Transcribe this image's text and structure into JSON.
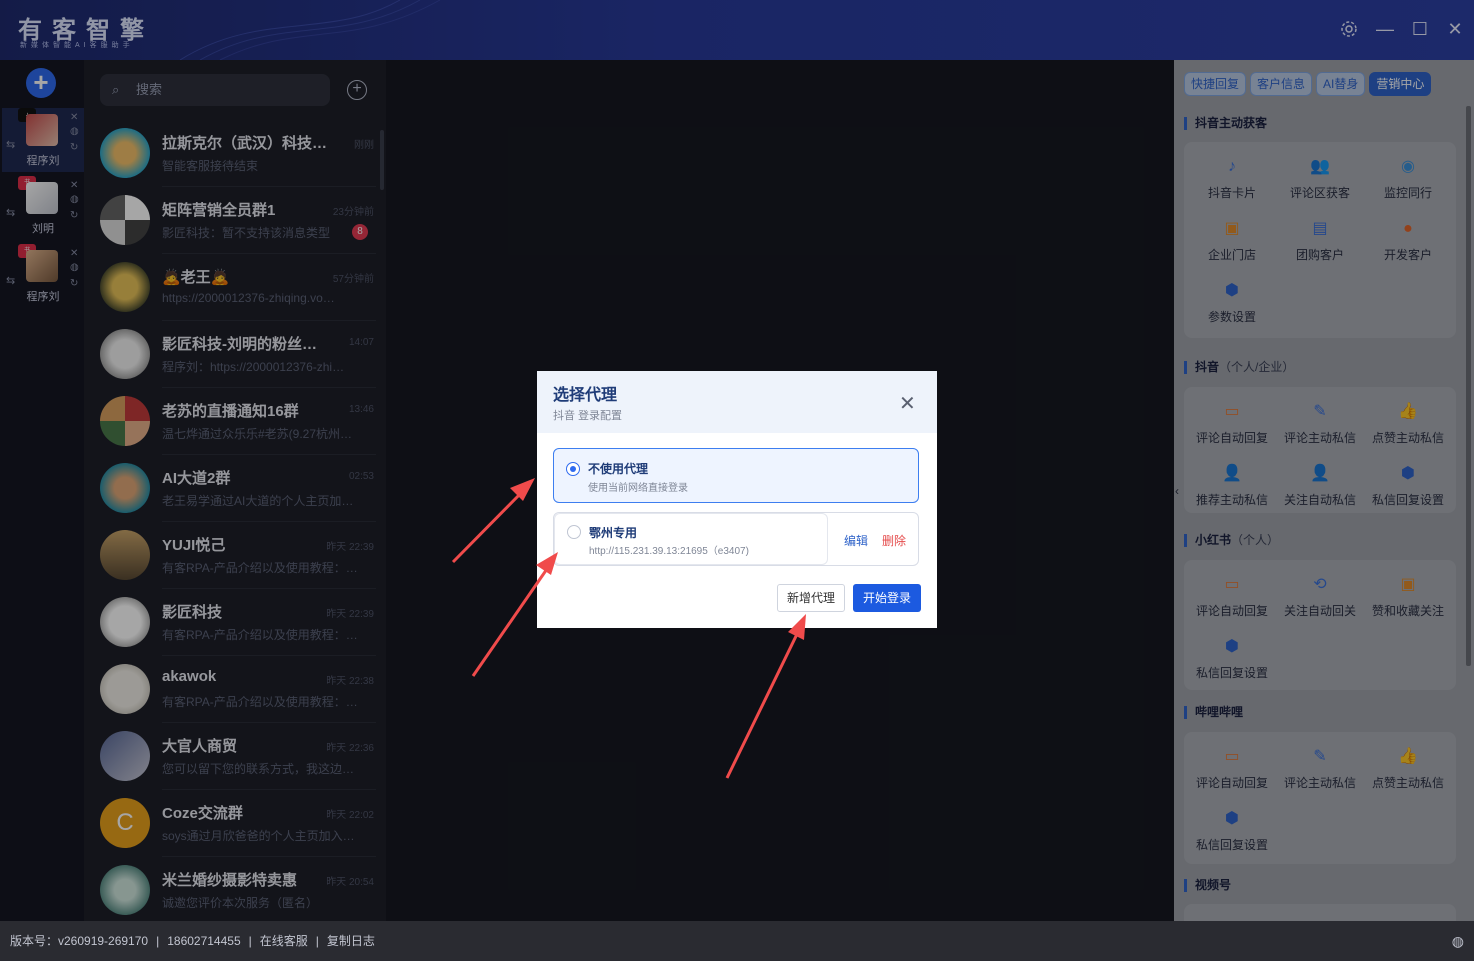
{
  "app": {
    "logo_title": "有客智擎",
    "logo_subtitle": "新媒体智能AI客服助手",
    "window_icons": [
      "gear-icon",
      "minimize-icon",
      "maximize-icon",
      "close-icon"
    ]
  },
  "accounts": [
    {
      "name": "程序刘",
      "platform": "抖音"
    },
    {
      "name": "刘明",
      "platform": "小红书"
    },
    {
      "name": "程序刘",
      "platform": "小红书"
    }
  ],
  "chat": {
    "search_placeholder": "搜索",
    "items": [
      {
        "name": "拉斯克尔（武汉）科技…",
        "time": "刚刚",
        "msg": "智能客服接待结束",
        "unread": ""
      },
      {
        "name": "矩阵营销全员群1",
        "time": "23分钟前",
        "msg": "影匠科技：暂不支持该消息类型",
        "unread": "8"
      },
      {
        "name": "🙇老王🙇",
        "time": "57分钟前",
        "msg": "https://2000012376-zhiqing.vo…",
        "unread": ""
      },
      {
        "name": "影匠科技-刘明的粉丝…",
        "time": "14:07",
        "msg": "程序刘：https://2000012376-zhi…",
        "unread": ""
      },
      {
        "name": "老苏的直播通知16群",
        "time": "13:46",
        "msg": "温七烨通过众乐乐#老苏(9.27杭州…",
        "unread": ""
      },
      {
        "name": "AI大道2群",
        "time": "02:53",
        "msg": "老王易学通过AI大道的个人主页加…",
        "unread": ""
      },
      {
        "name": "YUJI悦己",
        "time": "昨天 22:39",
        "msg": "有客RPA-产品介绍以及使用教程：…",
        "unread": ""
      },
      {
        "name": "影匠科技",
        "time": "昨天 22:39",
        "msg": "有客RPA-产品介绍以及使用教程：…",
        "unread": ""
      },
      {
        "name": "akawok",
        "time": "昨天 22:38",
        "msg": "有客RPA-产品介绍以及使用教程：…",
        "unread": ""
      },
      {
        "name": "大官人商贸",
        "time": "昨天 22:36",
        "msg": "您可以留下您的联系方式，我这边…",
        "unread": ""
      },
      {
        "name": "Coze交流群",
        "time": "昨天 22:02",
        "msg": "soys通过月欣爸爸的个人主页加入…",
        "unread": ""
      },
      {
        "name": "米兰婚纱摄影特卖惠",
        "time": "昨天 20:54",
        "msg": "诚邀您评价本次服务（匿名）",
        "unread": ""
      }
    ]
  },
  "right_panel": {
    "tabs": [
      "快捷回复",
      "客户信息",
      "AI替身",
      "营销中心"
    ],
    "active_tab": "营销中心",
    "sections": [
      {
        "title": "抖音主动获客",
        "suffix": "",
        "tools": [
          "抖音卡片",
          "评论区获客",
          "监控同行",
          "企业门店",
          "团购客户",
          "开发客户",
          "参数设置"
        ]
      },
      {
        "title": "抖音",
        "suffix": "（个人/企业）",
        "tools": [
          "评论自动回复",
          "评论主动私信",
          "点赞主动私信",
          "推荐主动私信",
          "关注自动私信",
          "私信回复设置"
        ]
      },
      {
        "title": "小红书",
        "suffix": "（个人）",
        "tools": [
          "评论自动回复",
          "关注自动回关",
          "赞和收藏关注",
          "私信回复设置"
        ]
      },
      {
        "title": "哔哩哔哩",
        "suffix": "",
        "tools": [
          "评论自动回复",
          "评论主动私信",
          "点赞主动私信",
          "私信回复设置"
        ]
      },
      {
        "title": "视频号",
        "suffix": "",
        "tools": []
      }
    ]
  },
  "status": {
    "version": "版本号：v260919-269170",
    "phone": "18602714455",
    "online_service": "在线客服",
    "copy_log": "复制日志"
  },
  "modal": {
    "title": "选择代理",
    "subtitle": "抖音 登录配置",
    "options": [
      {
        "title": "不使用代理",
        "desc": "使用当前网络直接登录",
        "selected": true
      },
      {
        "title": "鄂州专用",
        "desc": "http://115.231.39.13:21695（e3407)",
        "selected": false
      }
    ],
    "edit_label": "编辑",
    "delete_label": "删除",
    "new_proxy_label": "新增代理",
    "start_login_label": "开始登录"
  }
}
